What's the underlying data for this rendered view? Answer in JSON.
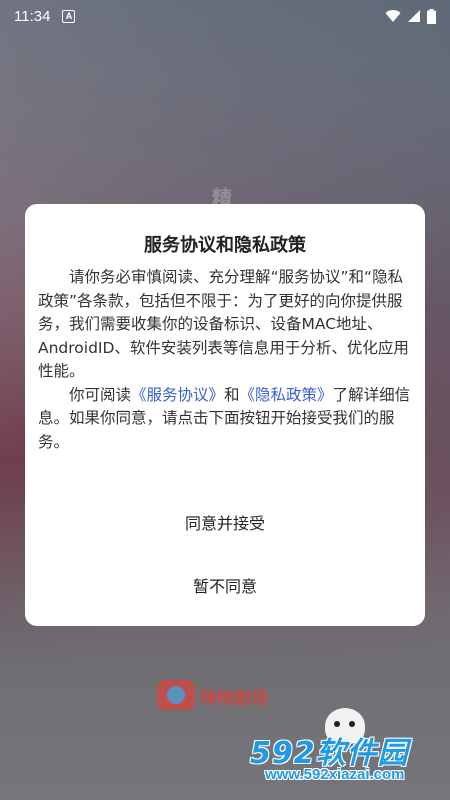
{
  "status_bar": {
    "time": "11:34",
    "notification_icon": "A"
  },
  "background": {
    "partial_title": "精",
    "app_name": "咪咪剧场"
  },
  "watermark": {
    "brand": "592软件园",
    "url": "www.592xiazai.com"
  },
  "dialog": {
    "title": "服务协议和隐私政策",
    "para1": "请你务必审慎阅读、充分理解“服务协议”和“隐私政策”各条款，包括但不限于：为了更好的向你提供服务，我们需要收集你的设备标识、设备MAC地址、AndroidID、软件安装列表等信息用于分析、优化应用性能。",
    "para2_prefix": "你可阅读",
    "link_service": "《服务协议》",
    "para2_and": "和",
    "link_privacy": "《隐私政策》",
    "para2_suffix": "了解详细信息。如果你同意，请点击下面按钮开始接受我们的服务。",
    "accept_label": "同意并接受",
    "decline_label": "暂不同意"
  },
  "colors": {
    "link": "#3a5fd0",
    "watermark": "#1e9be8"
  }
}
